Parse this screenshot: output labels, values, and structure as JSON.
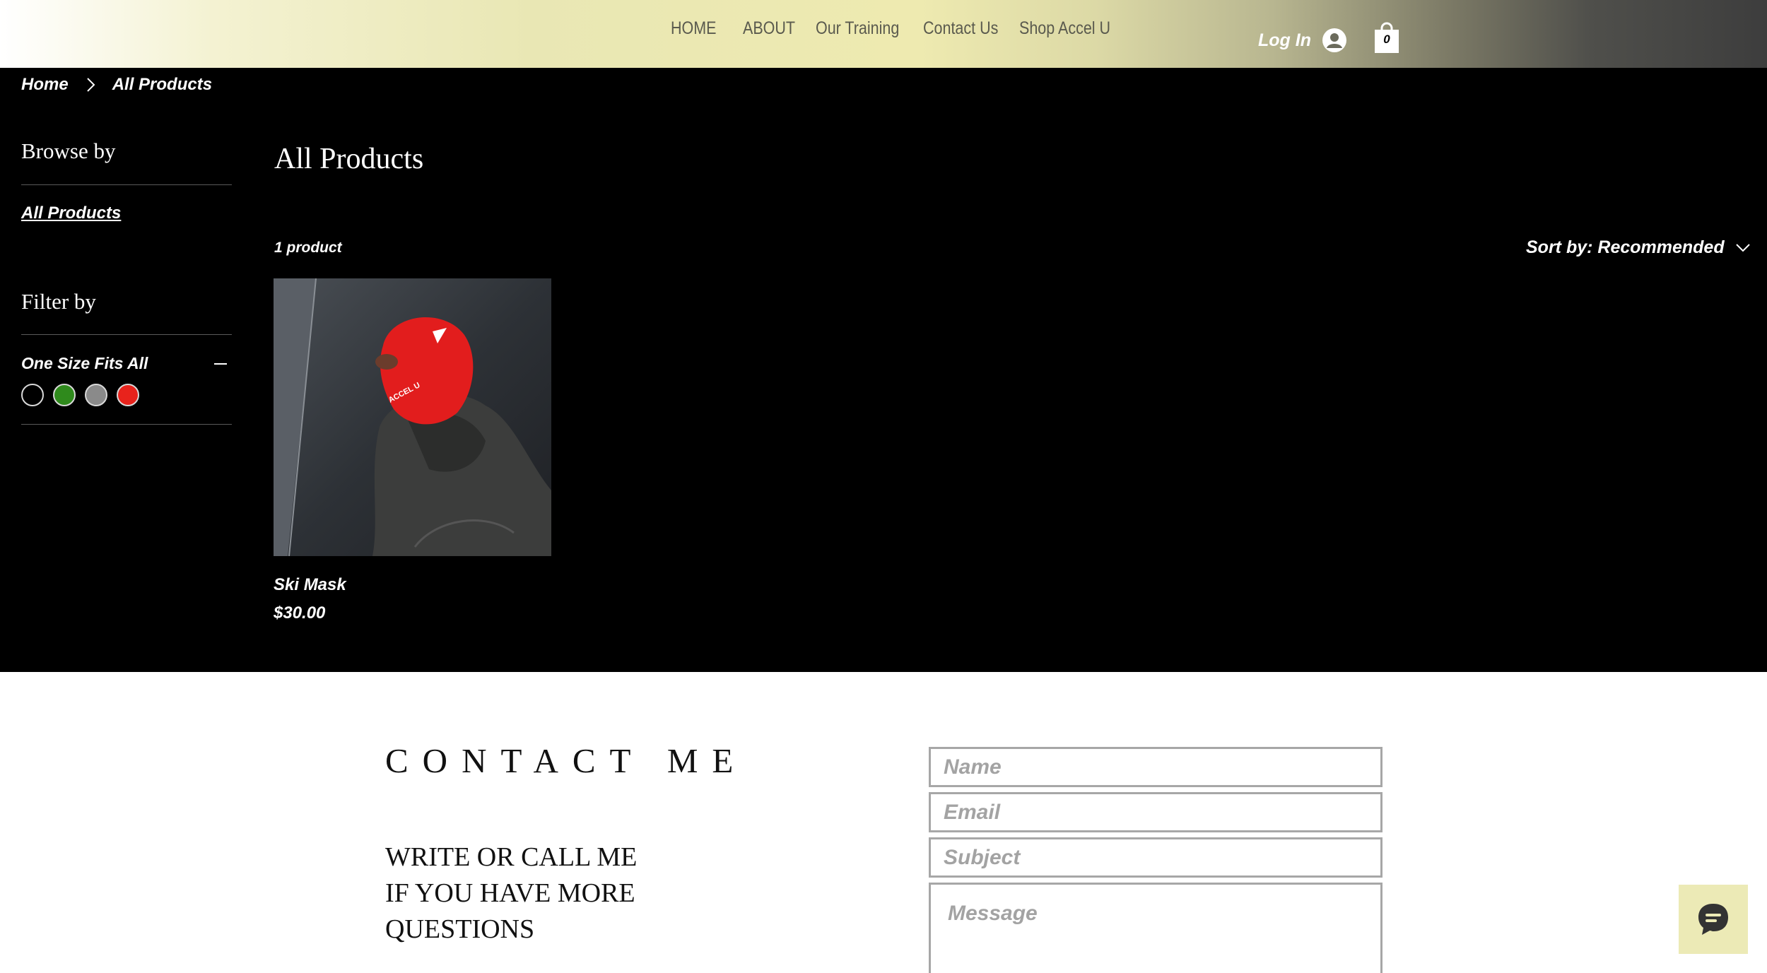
{
  "header": {
    "nav": [
      "HOME",
      "ABOUT",
      "Our Training",
      "Contact Us",
      "Shop Accel U"
    ],
    "login_label": "Log In",
    "cart_count": "0"
  },
  "breadcrumb": {
    "home": "Home",
    "current": "All Products"
  },
  "sidebar": {
    "browse_title": "Browse by",
    "browse_link": "All Products",
    "filter_title": "Filter by",
    "filter_option": "One Size Fits All",
    "swatch_colors": [
      "#000000",
      "#2f8a1c",
      "#8a8a8a",
      "#e8231c"
    ]
  },
  "main": {
    "title": "All Products",
    "product_count": "1 product",
    "sort_label": "Sort by: Recommended",
    "products": [
      {
        "name": "Ski Mask",
        "price": "$30.00",
        "image_text": "ACCEL U"
      }
    ]
  },
  "contact": {
    "title": "CONTACT ME",
    "lines": [
      "WRITE OR CALL ME",
      "IF YOU HAVE MORE",
      "QUESTIONS"
    ],
    "placeholders": {
      "name": "Name",
      "email": "Email",
      "subject": "Subject",
      "message": "Message"
    }
  },
  "icons": {
    "chevron": "chevron-right-icon",
    "avatar": "user-icon",
    "cart": "shopping-bag-icon",
    "chat": "chat-icon"
  }
}
